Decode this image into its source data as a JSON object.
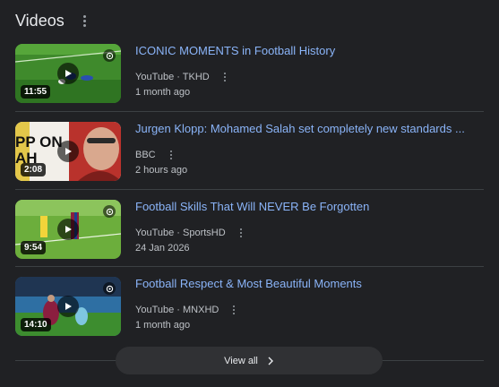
{
  "section": {
    "title": "Videos"
  },
  "videos": [
    {
      "title": "ICONIC MOMENTS in Football History",
      "source": "YouTube · TKHD",
      "date": "1 month ago",
      "duration": "11:55"
    },
    {
      "title": "Jurgen Klopp: Mohamed Salah set completely new standards ...",
      "source": "BBC",
      "date": "2 hours ago",
      "duration": "2:08",
      "thumb_text": [
        "PP ON",
        "AH"
      ]
    },
    {
      "title": "Football Skills That Will NEVER Be Forgotten",
      "source": "YouTube · SportsHD",
      "date": "24 Jan 2026",
      "duration": "9:54"
    },
    {
      "title": "Football Respect & Most Beautiful Moments",
      "source": "YouTube · MNXHD",
      "date": "1 month ago",
      "duration": "14:10"
    }
  ],
  "view_all_label": "View all",
  "colors": {
    "background": "#202124",
    "link": "#8ab4f8",
    "meta": "#bdc1c6",
    "button": "#303134"
  }
}
